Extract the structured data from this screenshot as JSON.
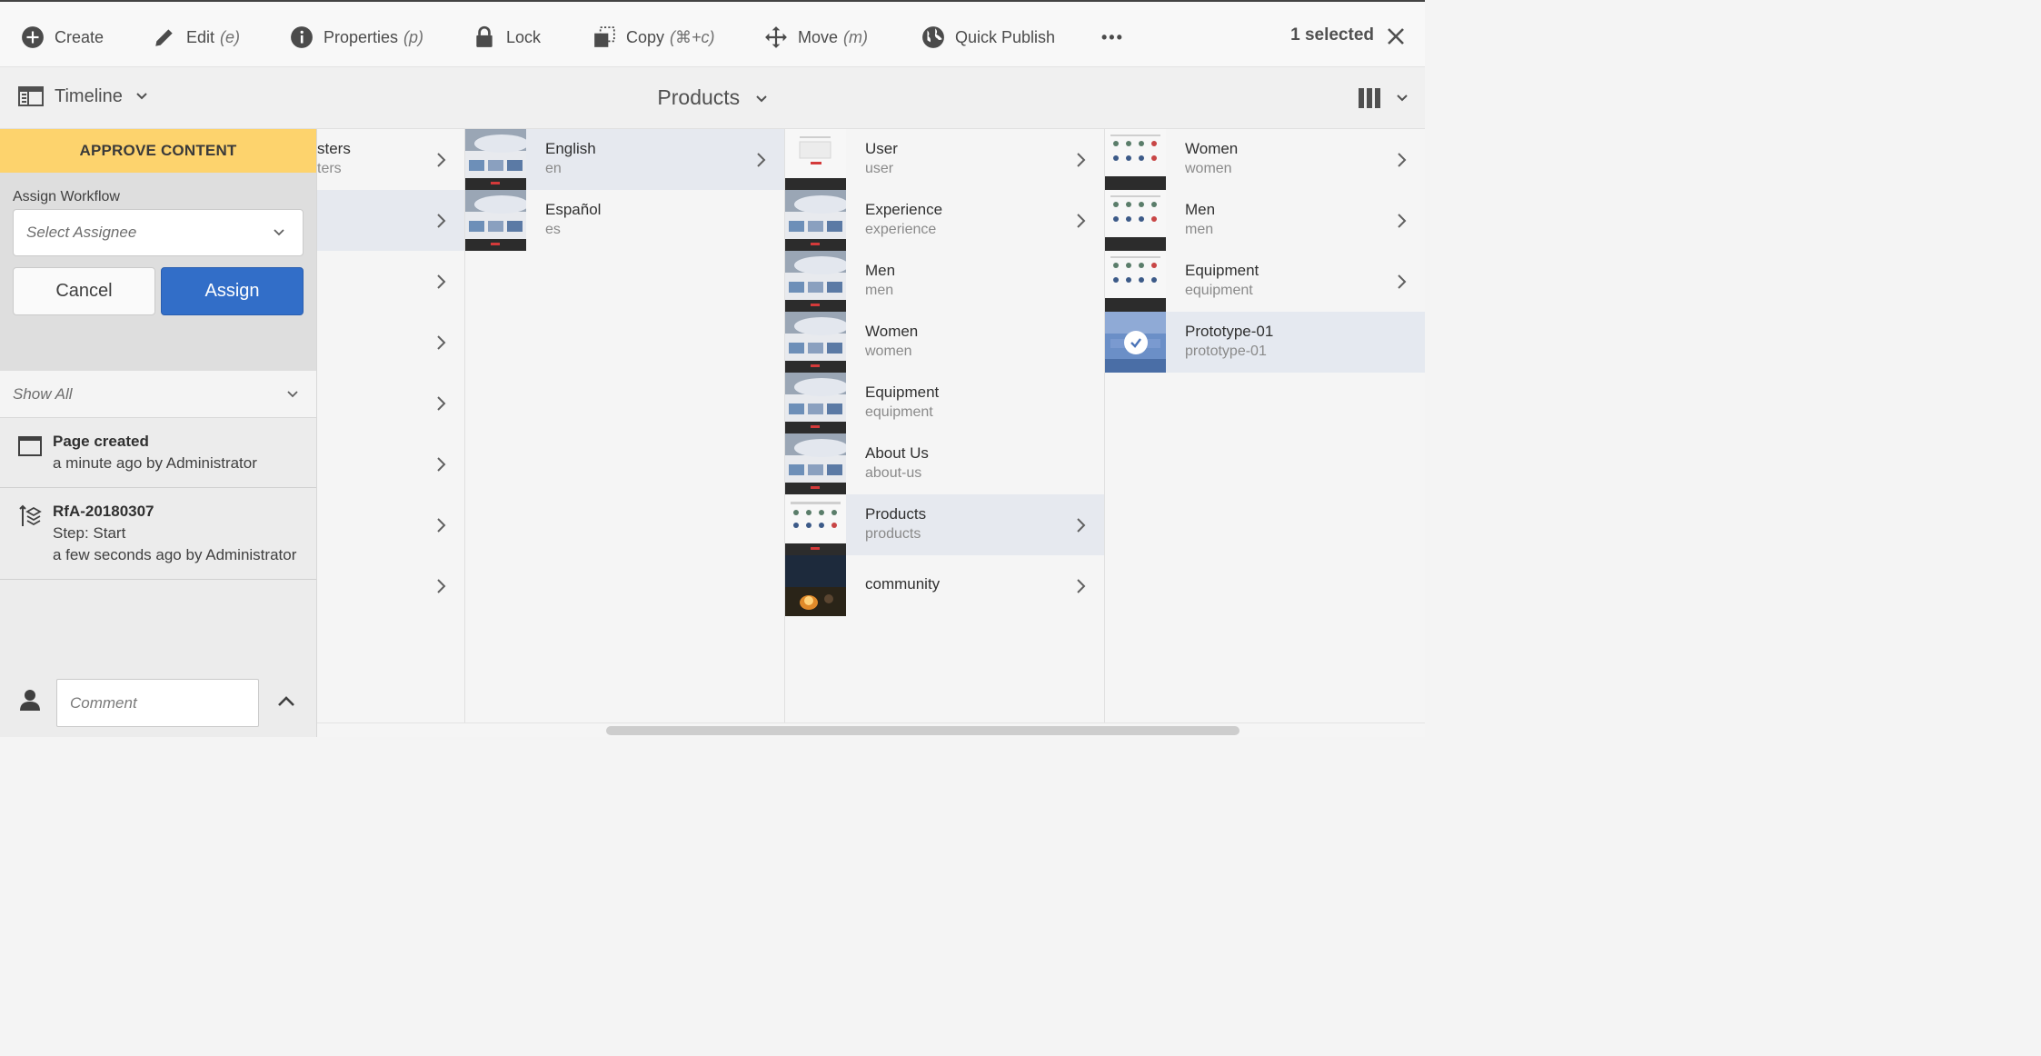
{
  "actionbar": {
    "create": "Create",
    "edit": "Edit",
    "edit_hint": "(e)",
    "properties": "Properties",
    "properties_hint": "(p)",
    "lock": "Lock",
    "copy": "Copy",
    "copy_hint": "(⌘+c)",
    "move": "Move",
    "move_hint": "(m)",
    "quick_publish": "Quick Publish",
    "more": "•••",
    "selected_count": "1 selected"
  },
  "subbar": {
    "rail_view": "Timeline",
    "title": "Products"
  },
  "rail": {
    "banner": "APPROVE CONTENT",
    "assign_label": "Assign Workflow",
    "assignee_placeholder": "Select Assignee",
    "cancel": "Cancel",
    "assign": "Assign",
    "filter": "Show All",
    "timeline": [
      {
        "title": "Page created",
        "lines": [
          "a minute ago by Administrator"
        ]
      },
      {
        "title": "RfA-20180307",
        "lines": [
          "Step: Start",
          "a few seconds ago by Administrator"
        ]
      }
    ],
    "comment_placeholder": "Comment"
  },
  "columns": {
    "col1": [
      {
        "name": "sters",
        "sub": "ters"
      },
      {
        "name": "",
        "sub": ""
      },
      {
        "name": "",
        "sub": ""
      },
      {
        "name": "",
        "sub": ""
      },
      {
        "name": "",
        "sub": ""
      },
      {
        "name": "",
        "sub": ""
      },
      {
        "name": "",
        "sub": ""
      },
      {
        "name": "",
        "sub": ""
      }
    ],
    "col2": [
      {
        "name": "English",
        "sub": "en"
      },
      {
        "name": "Español",
        "sub": "es"
      }
    ],
    "col3": [
      {
        "name": "User",
        "sub": "user"
      },
      {
        "name": "Experience",
        "sub": "experience"
      },
      {
        "name": "Men",
        "sub": "men"
      },
      {
        "name": "Women",
        "sub": "women"
      },
      {
        "name": "Equipment",
        "sub": "equipment"
      },
      {
        "name": "About Us",
        "sub": "about-us"
      },
      {
        "name": "Products",
        "sub": "products"
      },
      {
        "name": "community",
        "sub": ""
      }
    ],
    "col4": [
      {
        "name": "Women",
        "sub": "women"
      },
      {
        "name": "Men",
        "sub": "men"
      },
      {
        "name": "Equipment",
        "sub": "equipment"
      },
      {
        "name": "Prototype-01",
        "sub": "prototype-01"
      }
    ]
  },
  "colors": {
    "banner": "#fdd36d",
    "primary_button": "#326ec8",
    "selected_row": "#e5e9f0"
  }
}
